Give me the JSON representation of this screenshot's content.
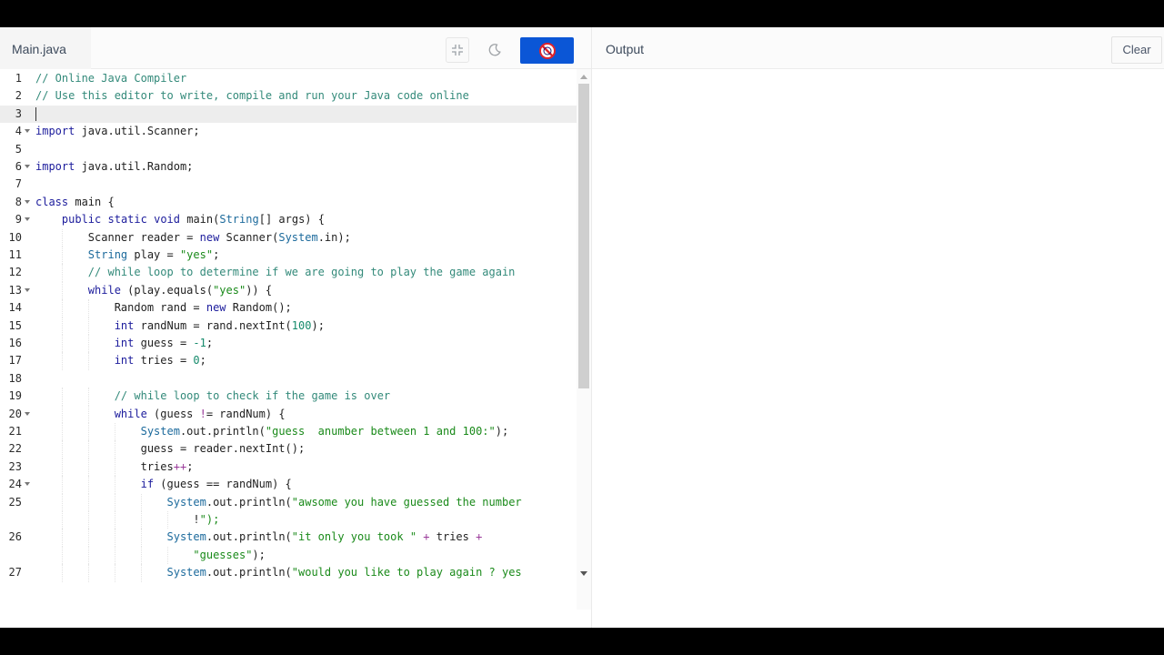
{
  "editor": {
    "file_tab": "Main.java",
    "fullscreen_icon": "fullscreen-exit-icon",
    "theme_icon": "moon-icon",
    "run_icon": "stop-icon",
    "run_button_color": "#0b56d6"
  },
  "output": {
    "title": "Output",
    "clear_label": "Clear",
    "content": ""
  },
  "code": {
    "active_line": 3,
    "lines": [
      {
        "n": "1",
        "text": "// Online Java Compiler"
      },
      {
        "n": "2",
        "text": "// Use this editor to write, compile and run your Java code online"
      },
      {
        "n": "3",
        "text": ""
      },
      {
        "n": "4",
        "text": "import java.util.Scanner;",
        "fold": true
      },
      {
        "n": "5",
        "text": ""
      },
      {
        "n": "6",
        "text": "import java.util.Random;",
        "fold": true
      },
      {
        "n": "7",
        "text": ""
      },
      {
        "n": "8",
        "text": "class main {",
        "fold": true
      },
      {
        "n": "9",
        "text": "    public static void main(String[] args) {",
        "fold": true
      },
      {
        "n": "10",
        "text": "        Scanner reader = new Scanner(System.in);"
      },
      {
        "n": "11",
        "text": "        String play = \"yes\";"
      },
      {
        "n": "12",
        "text": "        // while loop to determine if we are going to play the game again"
      },
      {
        "n": "13",
        "text": "        while (play.equals(\"yes\")) {",
        "fold": true
      },
      {
        "n": "14",
        "text": "            Random rand = new Random();"
      },
      {
        "n": "15",
        "text": "            int randNum = rand.nextInt(100);"
      },
      {
        "n": "16",
        "text": "            int guess = -1;"
      },
      {
        "n": "17",
        "text": "            int tries = 0;"
      },
      {
        "n": "18",
        "text": ""
      },
      {
        "n": "19",
        "text": "            // while loop to check if the game is over"
      },
      {
        "n": "20",
        "text": "            while (guess != randNum) {",
        "fold": true
      },
      {
        "n": "21",
        "text": "                System.out.println(\"guess  anumber between 1 and 100:\");"
      },
      {
        "n": "22",
        "text": "                guess = reader.nextInt();"
      },
      {
        "n": "23",
        "text": "                tries++;"
      },
      {
        "n": "24",
        "text": "                if (guess == randNum) {",
        "fold": true
      },
      {
        "n": "25",
        "text": "                    System.out.println(\"awsome you have guessed the number"
      },
      {
        "n": "",
        "text": "                        !\");"
      },
      {
        "n": "26",
        "text": "                    System.out.println(\"it only you took \" + tries +"
      },
      {
        "n": "",
        "text": "                        \"guesses\");"
      },
      {
        "n": "27",
        "text": "                    System.out.println(\"would you like to play again ? yes"
      }
    ]
  }
}
